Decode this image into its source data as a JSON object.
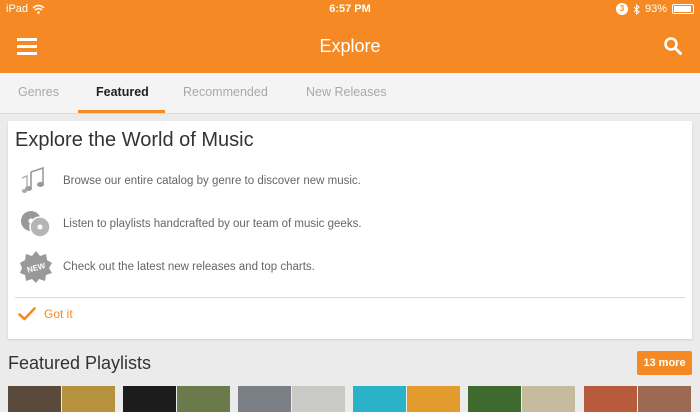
{
  "status_bar": {
    "device": "iPad",
    "time": "6:57 PM",
    "notification_count": "3",
    "battery_percent": "93%",
    "battery_level": 0.93,
    "icons": [
      "wifi-icon",
      "notification-badge-icon",
      "bluetooth-icon",
      "battery-icon"
    ]
  },
  "header": {
    "title": "Explore",
    "menu_icon": "hamburger-menu-icon",
    "search_icon": "search-icon",
    "accent_color": "#f58a24"
  },
  "tabs": [
    {
      "label": "Genres",
      "active": false
    },
    {
      "label": "Featured",
      "active": true
    },
    {
      "label": "Recommended",
      "active": false
    },
    {
      "label": "New Releases",
      "active": false
    }
  ],
  "intro_card": {
    "title": "Explore the World of Music",
    "items": [
      {
        "icon": "music-notes-icon",
        "text": "Browse our entire catalog by genre to discover new music."
      },
      {
        "icon": "vinyl-discs-icon",
        "text": "Listen to playlists handcrafted by our team of music geeks."
      },
      {
        "icon": "new-badge-icon",
        "text": "Check out the latest new releases and top charts.",
        "badge_text": "NEW"
      }
    ],
    "dismiss": {
      "icon": "checkmark-icon",
      "label": "Got it"
    }
  },
  "featured_playlists": {
    "title": "Featured Playlists",
    "more_label": "13 more",
    "thumbnails": [
      {
        "color": "#5a4a3c"
      },
      {
        "color": "#b6923e"
      },
      {
        "color": "#1c1c1c"
      },
      {
        "color": "#6a7a4a"
      },
      {
        "color": "#7a7f86"
      },
      {
        "color": "#c9c9c6"
      },
      {
        "color": "#2ab2c9"
      },
      {
        "color": "#e39b2e"
      },
      {
        "color": "#3f6a2f"
      },
      {
        "color": "#c6bb9f"
      },
      {
        "color": "#b85a3c"
      },
      {
        "color": "#9c6a52"
      }
    ]
  }
}
